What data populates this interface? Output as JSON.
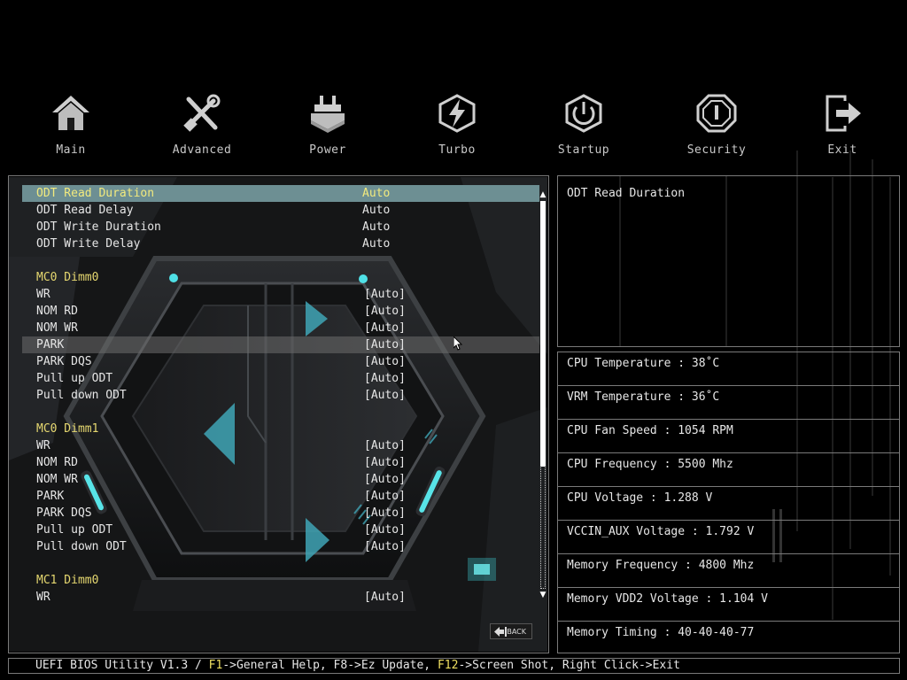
{
  "nav": {
    "items": [
      {
        "label": "Main",
        "icon": "home-icon"
      },
      {
        "label": "Advanced",
        "icon": "tools-icon"
      },
      {
        "label": "Power",
        "icon": "chip-icon"
      },
      {
        "label": "Turbo",
        "icon": "lightning-icon"
      },
      {
        "label": "Startup",
        "icon": "power-icon"
      },
      {
        "label": "Security",
        "icon": "shield-icon"
      },
      {
        "label": "Exit",
        "icon": "exit-icon"
      }
    ]
  },
  "settings": {
    "rows": [
      {
        "label": "ODT Read Duration",
        "value": "Auto"
      },
      {
        "label": "ODT Read Delay",
        "value": "Auto"
      },
      {
        "label": "ODT Write Duration",
        "value": "Auto"
      },
      {
        "label": "ODT Write Delay",
        "value": "Auto"
      },
      {
        "label": "MC0 Dimm0",
        "value": ""
      },
      {
        "label": "WR",
        "value": "[Auto]"
      },
      {
        "label": "NOM RD",
        "value": "[Auto]"
      },
      {
        "label": "NOM WR",
        "value": "[Auto]"
      },
      {
        "label": "PARK",
        "value": "[Auto]"
      },
      {
        "label": "PARK DQS",
        "value": "[Auto]"
      },
      {
        "label": "Pull up ODT",
        "value": "[Auto]"
      },
      {
        "label": "Pull down ODT",
        "value": "[Auto]"
      },
      {
        "label": "MC0 Dimm1",
        "value": ""
      },
      {
        "label": "WR",
        "value": "[Auto]"
      },
      {
        "label": "NOM RD",
        "value": "[Auto]"
      },
      {
        "label": "NOM WR",
        "value": "[Auto]"
      },
      {
        "label": "PARK",
        "value": "[Auto]"
      },
      {
        "label": "PARK DQS",
        "value": "[Auto]"
      },
      {
        "label": "Pull up ODT",
        "value": "[Auto]"
      },
      {
        "label": "Pull down ODT",
        "value": "[Auto]"
      },
      {
        "label": "MC1 Dimm0",
        "value": ""
      },
      {
        "label": "WR",
        "value": "[Auto]"
      }
    ],
    "back_label": "BACK"
  },
  "help": {
    "title": "ODT Read Duration"
  },
  "hardware": {
    "items": [
      "CPU Temperature : 38˚C",
      "VRM Temperature : 36˚C",
      "CPU Fan Speed : 1054 RPM",
      "CPU Frequency : 5500 Mhz",
      "CPU Voltage : 1.288 V",
      "VCCIN_AUX Voltage : 1.792 V",
      "Memory Frequency : 4800 Mhz",
      "Memory VDD2 Voltage : 1.104 V",
      "Memory Timing : 40-40-40-77"
    ]
  },
  "footer": {
    "prefix": "UEFI BIOS Utility V1.3 / ",
    "key1": "F1",
    "text1": "->General Help, F8->Ez Update, ",
    "key2": "F12",
    "text2": "->Screen Shot, Right Click->Exit"
  },
  "colors": {
    "highlight_text": "#f2ea7e",
    "section_text": "#e6d870",
    "selected_bg": "#6d8f93",
    "accent_cyan": "#3fc9cf",
    "border": "#7a7a7a"
  }
}
